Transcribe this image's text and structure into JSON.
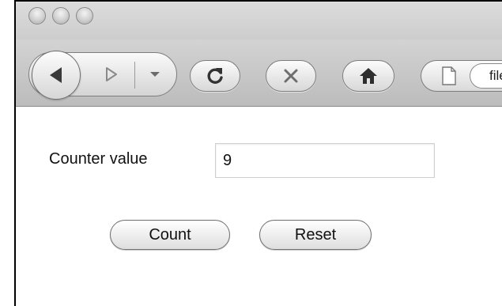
{
  "window": {
    "buttons": [
      "close",
      "minimize",
      "zoom"
    ]
  },
  "toolbar": {
    "back_icon": "back-arrow-icon",
    "forward_icon": "forward-arrow-icon",
    "history_icon": "chevron-down-icon",
    "reload_icon": "reload-icon",
    "stop_icon": "stop-icon",
    "home_icon": "home-icon",
    "page_icon": "document-icon",
    "url_text": "file"
  },
  "form": {
    "counter_label": "Counter value",
    "counter_value": "9",
    "count_button": "Count",
    "reset_button": "Reset"
  }
}
